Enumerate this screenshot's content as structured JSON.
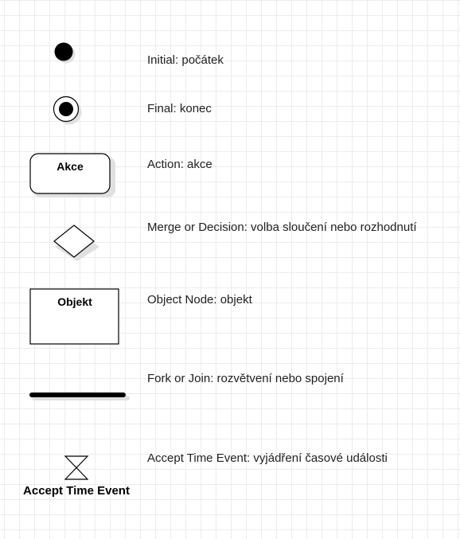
{
  "shapes": {
    "action_label": "Akce",
    "object_label": "Objekt",
    "time_event_label": "Accept Time Event"
  },
  "legend": [
    {
      "name": "Initial",
      "text": "Initial: počátek"
    },
    {
      "name": "Final",
      "text": "Final: konec"
    },
    {
      "name": "Action",
      "text": "Action: akce"
    },
    {
      "name": "Merge or Decision",
      "text": "Merge or Decision: volba sloučení nebo rozhodnutí"
    },
    {
      "name": "Object Node",
      "text": "Object Node: objekt"
    },
    {
      "name": "Fork or Join",
      "text": "Fork or Join: rozvětvení nebo spojení"
    },
    {
      "name": "Accept Time Event",
      "text": "Accept Time Event: vyjádření časové události"
    }
  ]
}
